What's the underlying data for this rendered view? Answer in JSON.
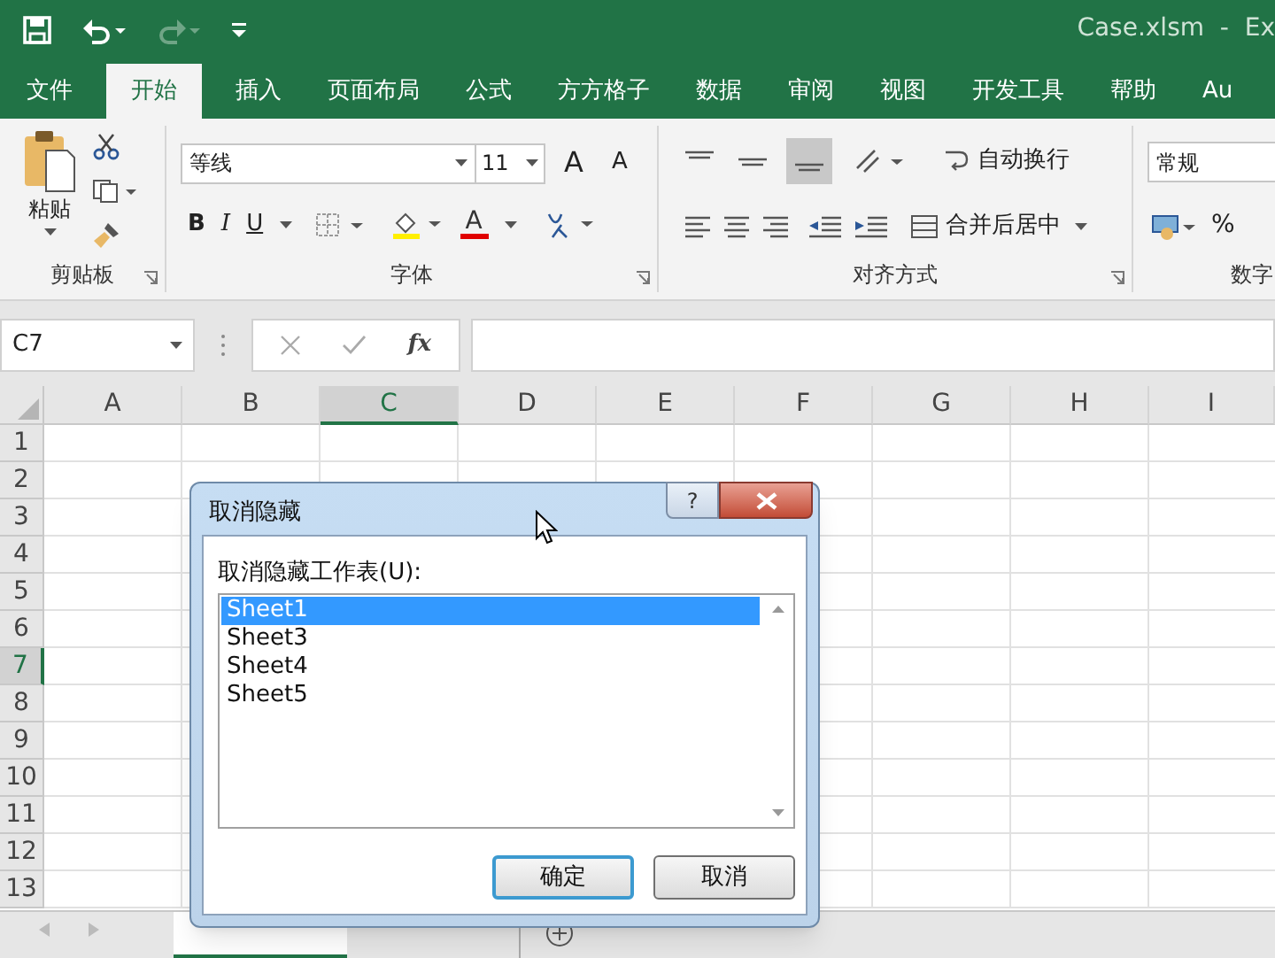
{
  "title_bar": {
    "file_name": "Case.xlsm  -  Ex"
  },
  "ribbon_tabs": [
    {
      "label": "文件",
      "selected": false
    },
    {
      "label": "开始",
      "selected": true
    },
    {
      "label": "插入",
      "selected": false
    },
    {
      "label": "页面布局",
      "selected": false
    },
    {
      "label": "公式",
      "selected": false
    },
    {
      "label": "方方格子",
      "selected": false
    },
    {
      "label": "数据",
      "selected": false
    },
    {
      "label": "审阅",
      "selected": false
    },
    {
      "label": "视图",
      "selected": false
    },
    {
      "label": "开发工具",
      "selected": false
    },
    {
      "label": "帮助",
      "selected": false
    },
    {
      "label": "Au",
      "selected": false
    }
  ],
  "clipboard": {
    "paste": "粘贴",
    "group": "剪贴板"
  },
  "font": {
    "font_name": "等线",
    "font_size": "11",
    "grow_font": "A",
    "shrink_font": "A",
    "bold": "B",
    "italic": "I",
    "underline": "U",
    "font_color": "A",
    "group": "字体"
  },
  "alignment": {
    "wrap_text": "自动换行",
    "merge": "合并后居中",
    "group": "对齐方式"
  },
  "number": {
    "format": "常规",
    "percent": "%",
    "group": "数字"
  },
  "formula_bar": {
    "name_box": "C7",
    "fx": "fx"
  },
  "columns": [
    {
      "label": "A",
      "selected": false
    },
    {
      "label": "B",
      "selected": false
    },
    {
      "label": "C",
      "selected": true
    },
    {
      "label": "D",
      "selected": false
    },
    {
      "label": "E",
      "selected": false
    },
    {
      "label": "F",
      "selected": false
    },
    {
      "label": "G",
      "selected": false
    },
    {
      "label": "H",
      "selected": false
    },
    {
      "label": "I",
      "selected": false
    }
  ],
  "rows": [
    {
      "label": "1",
      "selected": false
    },
    {
      "label": "2",
      "selected": false
    },
    {
      "label": "3",
      "selected": false
    },
    {
      "label": "4",
      "selected": false
    },
    {
      "label": "5",
      "selected": false
    },
    {
      "label": "6",
      "selected": false
    },
    {
      "label": "7",
      "selected": true
    },
    {
      "label": "8",
      "selected": false
    },
    {
      "label": "9",
      "selected": false
    },
    {
      "label": "10",
      "selected": false
    },
    {
      "label": "11",
      "selected": false
    },
    {
      "label": "12",
      "selected": false
    },
    {
      "label": "13",
      "selected": false
    }
  ],
  "sheet_tabs": [
    {
      "selected": true
    },
    {
      "selected": false
    }
  ],
  "dialog": {
    "title": "取消隐藏",
    "help": "?",
    "label": "取消隐藏工作表(U):",
    "sheets": [
      {
        "name": "Sheet1",
        "selected": true
      },
      {
        "name": "Sheet3",
        "selected": false
      },
      {
        "name": "Sheet4",
        "selected": false
      },
      {
        "name": "Sheet5",
        "selected": false
      }
    ],
    "buttons": [
      {
        "label": "确定",
        "default": true
      },
      {
        "label": "取消",
        "default": false
      }
    ]
  }
}
